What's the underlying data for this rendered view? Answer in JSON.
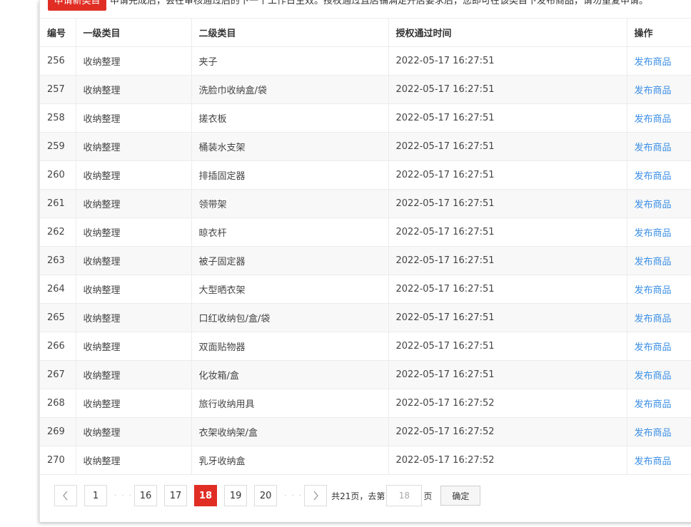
{
  "toolbar": {
    "apply_label": "申请新类目",
    "notice": "申请完成后，会在审核通过后的下一个工作日生效。授权通过且店铺满足开店要求后，您即可在该类目下发布商品，请勿重复申请。"
  },
  "table": {
    "headers": [
      "编号",
      "一级类目",
      "二级类目",
      "授权通过时间",
      "操作"
    ],
    "rows": [
      {
        "id": "256",
        "cat1": "收纳整理",
        "cat2": "夹子",
        "time": "2022-05-17 16:27:51",
        "action": "发布商品"
      },
      {
        "id": "257",
        "cat1": "收纳整理",
        "cat2": "洗脸巾收纳盒/袋",
        "time": "2022-05-17 16:27:51",
        "action": "发布商品"
      },
      {
        "id": "258",
        "cat1": "收纳整理",
        "cat2": "搓衣板",
        "time": "2022-05-17 16:27:51",
        "action": "发布商品"
      },
      {
        "id": "259",
        "cat1": "收纳整理",
        "cat2": "桶装水支架",
        "time": "2022-05-17 16:27:51",
        "action": "发布商品"
      },
      {
        "id": "260",
        "cat1": "收纳整理",
        "cat2": "排插固定器",
        "time": "2022-05-17 16:27:51",
        "action": "发布商品"
      },
      {
        "id": "261",
        "cat1": "收纳整理",
        "cat2": "领带架",
        "time": "2022-05-17 16:27:51",
        "action": "发布商品"
      },
      {
        "id": "262",
        "cat1": "收纳整理",
        "cat2": "晾衣杆",
        "time": "2022-05-17 16:27:51",
        "action": "发布商品"
      },
      {
        "id": "263",
        "cat1": "收纳整理",
        "cat2": "被子固定器",
        "time": "2022-05-17 16:27:51",
        "action": "发布商品"
      },
      {
        "id": "264",
        "cat1": "收纳整理",
        "cat2": "大型晒衣架",
        "time": "2022-05-17 16:27:51",
        "action": "发布商品"
      },
      {
        "id": "265",
        "cat1": "收纳整理",
        "cat2": "口红收纳包/盒/袋",
        "time": "2022-05-17 16:27:51",
        "action": "发布商品"
      },
      {
        "id": "266",
        "cat1": "收纳整理",
        "cat2": "双面贴物器",
        "time": "2022-05-17 16:27:51",
        "action": "发布商品"
      },
      {
        "id": "267",
        "cat1": "收纳整理",
        "cat2": "化妆箱/盒",
        "time": "2022-05-17 16:27:51",
        "action": "发布商品"
      },
      {
        "id": "268",
        "cat1": "收纳整理",
        "cat2": "旅行收纳用具",
        "time": "2022-05-17 16:27:52",
        "action": "发布商品"
      },
      {
        "id": "269",
        "cat1": "收纳整理",
        "cat2": "衣架收纳架/盒",
        "time": "2022-05-17 16:27:52",
        "action": "发布商品"
      },
      {
        "id": "270",
        "cat1": "收纳整理",
        "cat2": "乳牙收纳盒",
        "time": "2022-05-17 16:27:52",
        "action": "发布商品"
      }
    ]
  },
  "pagination": {
    "prev_icon": "chevron-left-icon",
    "next_icon": "chevron-right-icon",
    "first": "1",
    "ellipsis": "· · ·",
    "pages": [
      "16",
      "17",
      "18",
      "19",
      "20"
    ],
    "current": "18",
    "total_text": "共21页，去第",
    "goto_value": "18",
    "page_suffix": "页",
    "confirm_label": "确定"
  },
  "colors": {
    "accent": "#e02e24",
    "link": "#3a8ee6"
  }
}
